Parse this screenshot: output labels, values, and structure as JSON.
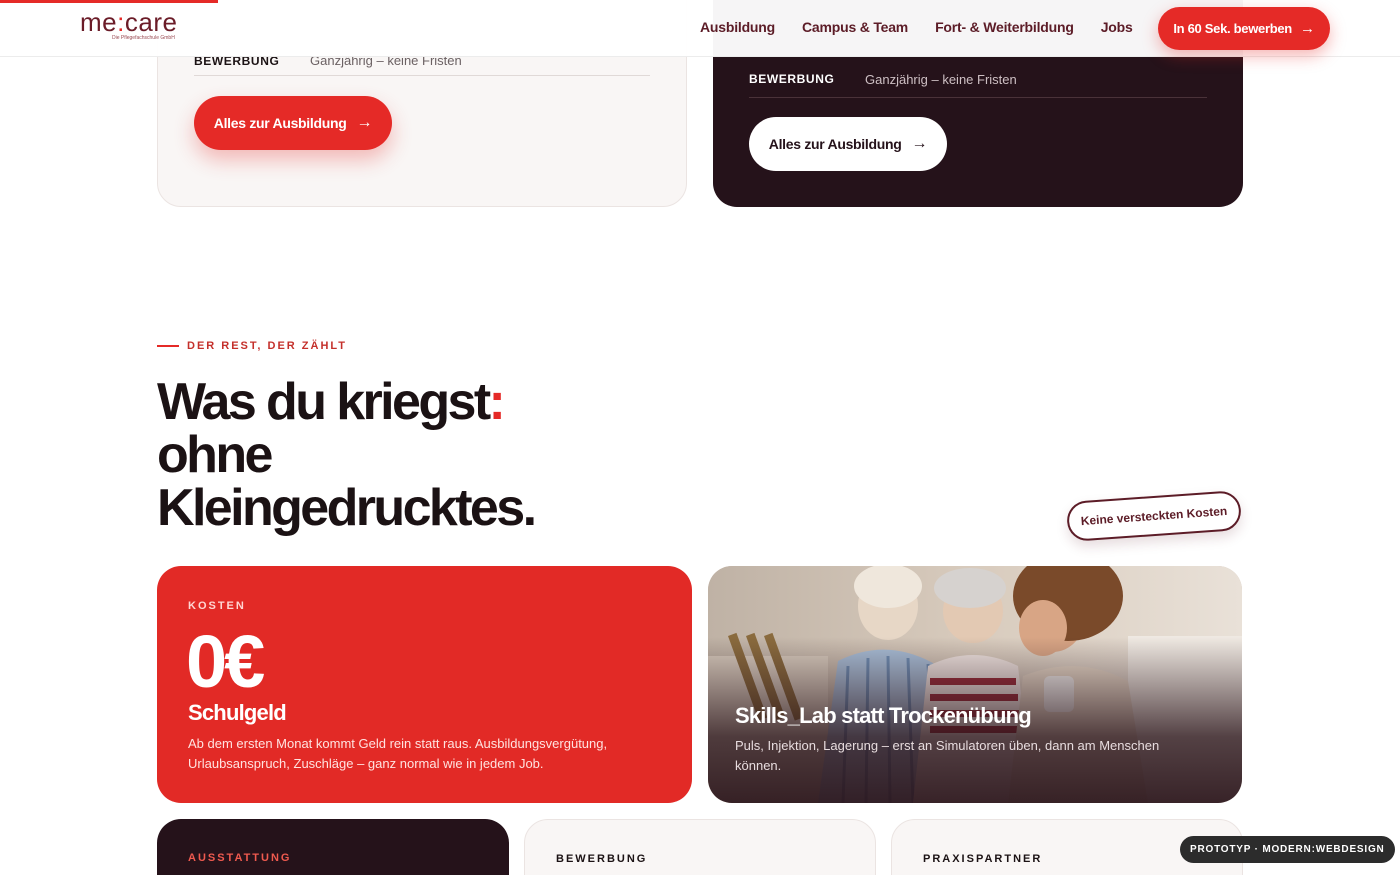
{
  "header": {
    "logo_main": "me",
    "logo_colon": ":",
    "logo_rest": "care",
    "logo_sub": "Die Pflegefachschule GmbH",
    "nav": [
      "Ausbildung",
      "Campus & Team",
      "Fort- & Weiterbildung",
      "Jobs"
    ],
    "cta_label": "In 60 Sek. bewerben",
    "cta_icon": "arrow-right-icon"
  },
  "top_cards": {
    "left": {
      "row_key": "BEWERBUNG",
      "row_value": "Ganzjährig – keine Fristen",
      "button_label": "Alles zur Ausbildung"
    },
    "right": {
      "row_key": "BEWERBUNG",
      "row_value": "Ganzjährig – keine Fristen",
      "button_label": "Alles zur Ausbildung"
    }
  },
  "section": {
    "eyebrow": "DER REST, DER ZÄHLT",
    "headline_line1": "Was du kriegst",
    "headline_colon": ":",
    "headline_line2": "ohne",
    "headline_line3": "Kleingedrucktes.",
    "sticker": "Keine versteckten Kosten"
  },
  "cards": {
    "kosten": {
      "label": "KOSTEN",
      "big": "0€",
      "title": "Schulgeld",
      "desc": "Ab dem ersten Monat kommt Geld rein statt raus. Ausbildungsvergütung, Urlaubsanspruch, Zuschläge – ganz normal wie in jedem Job."
    },
    "skills": {
      "title": "Skills_Lab statt Trockenübung",
      "desc": "Puls, Injektion, Lagerung – erst an Simulatoren üben, dann am Menschen können."
    },
    "bottom": [
      "AUSSTATTUNG",
      "BEWERBUNG",
      "PRAXISPARTNER"
    ]
  },
  "badge": "PROTOTYP · MODERN:WEBDESIGN",
  "colors": {
    "accent": "#e52a27",
    "dark": "#25121a",
    "brand": "#6b1c28"
  }
}
